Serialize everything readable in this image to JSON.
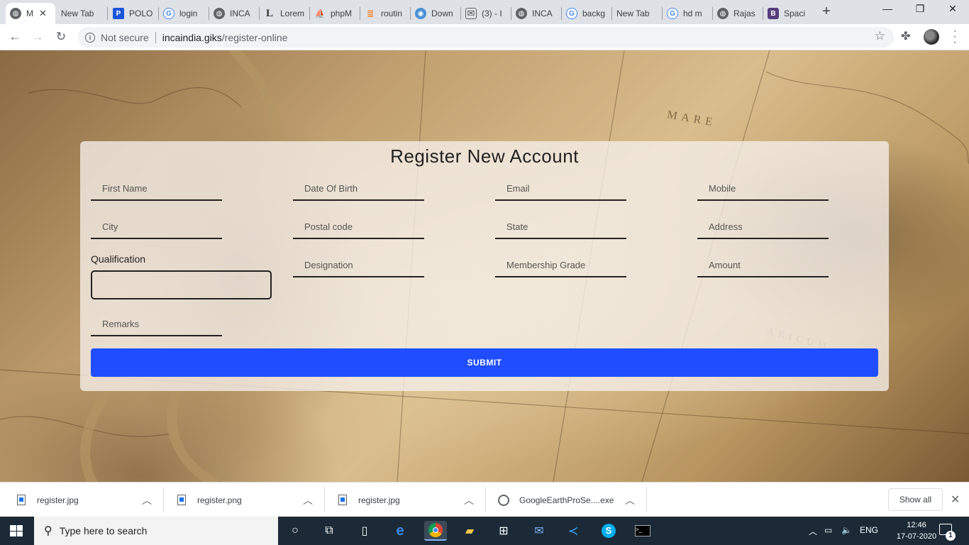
{
  "browser": {
    "tabs": [
      {
        "title": "M",
        "favicon": "globe-icon",
        "active": true
      },
      {
        "title": "New Tab",
        "favicon": "none"
      },
      {
        "title": "POLO",
        "favicon": "p-logo-icon"
      },
      {
        "title": "login",
        "favicon": "google-icon"
      },
      {
        "title": "INCA",
        "favicon": "globe-icon"
      },
      {
        "title": "Lorem",
        "favicon": "l-logo-icon"
      },
      {
        "title": "phpM",
        "favicon": "phpmyadmin-icon"
      },
      {
        "title": "routin",
        "favicon": "stackoverflow-icon"
      },
      {
        "title": "Down",
        "favicon": "download-globe-icon"
      },
      {
        "title": "(3) - I",
        "favicon": "mail-icon"
      },
      {
        "title": "INCA",
        "favicon": "globe-icon"
      },
      {
        "title": "backg",
        "favicon": "google-icon"
      },
      {
        "title": "New Tab",
        "favicon": "none"
      },
      {
        "title": "hd m",
        "favicon": "google-icon"
      },
      {
        "title": "Rajas",
        "favicon": "globe-icon"
      },
      {
        "title": "Spaci",
        "favicon": "bootstrap-icon"
      }
    ],
    "security_label": "Not secure",
    "url_host": "incaindia.giks",
    "url_path": "/register-online"
  },
  "form": {
    "title": "Register New Account",
    "fields": {
      "first_name": "First Name",
      "dob": "Date Of Birth",
      "email": "Email",
      "mobile": "Mobile",
      "city": "City",
      "postal": "Postal code",
      "state": "State",
      "address": "Address",
      "designation": "Designation",
      "membership": "Membership Grade",
      "amount": "Amount",
      "remarks": "Remarks"
    },
    "qualification_label": "Qualification",
    "submit_label": "SUBMIT",
    "accent": "#1f4dff"
  },
  "downloads": {
    "items": [
      "register.jpg",
      "register.png",
      "register.jpg",
      "GoogleEarthProSe....exe"
    ],
    "show_all": "Show all"
  },
  "taskbar": {
    "search_placeholder": "Type here to search",
    "language": "ENG",
    "time": "12:46",
    "date": "17-07-2020",
    "notification_count": "1"
  }
}
